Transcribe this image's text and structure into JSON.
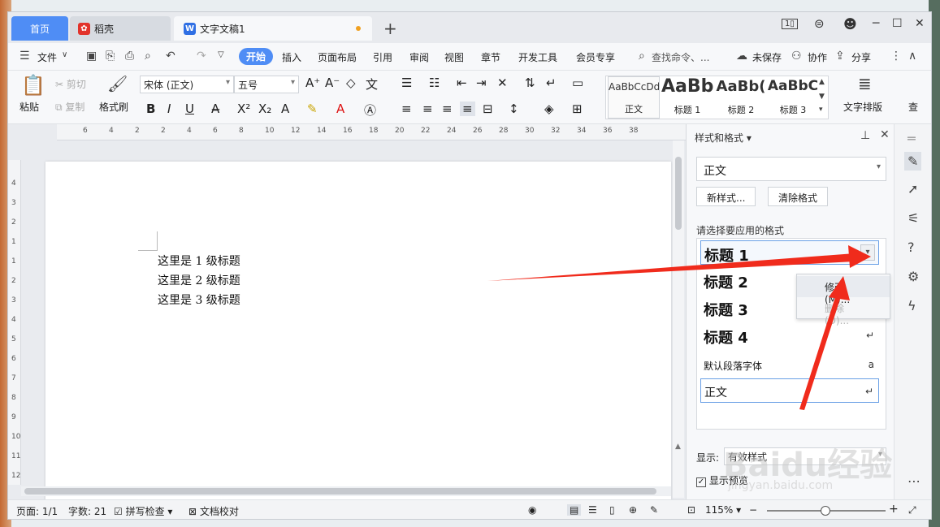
{
  "tabs": {
    "home": "首页",
    "daoke": "稻壳",
    "doc": "文字文稿1"
  },
  "menu": {
    "file": "文件",
    "start": "开始",
    "insert": "插入",
    "layout": "页面布局",
    "ref": "引用",
    "review": "审阅",
    "view": "视图",
    "chapter": "章节",
    "dev": "开发工具",
    "member": "会员专享",
    "search": "查找命令、...",
    "unsaved": "未保存",
    "collab": "协作",
    "share": "分享"
  },
  "ribbon": {
    "paste": "粘贴",
    "cut": "剪切",
    "copy": "复制",
    "format_painter": "格式刷",
    "font": "宋体 (正文)",
    "size": "五号",
    "text_layout": "文字排版",
    "find": "查"
  },
  "gallery": [
    {
      "preview": "AaBbCcDd",
      "name": "正文"
    },
    {
      "preview": "AaBb",
      "name": "标题 1"
    },
    {
      "preview": "AaBb(",
      "name": "标题 2"
    },
    {
      "preview": "AaBbC",
      "name": "标题 3"
    }
  ],
  "ruler": {
    "h": [
      "6",
      "4",
      "2",
      "2",
      "4",
      "6",
      "8",
      "10",
      "12",
      "14",
      "16",
      "18",
      "20",
      "22",
      "24",
      "26",
      "28",
      "30",
      "32",
      "34",
      "36",
      "38"
    ],
    "v": [
      "4",
      "3",
      "2",
      "1",
      "1",
      "2",
      "3",
      "4",
      "5",
      "6",
      "7",
      "8",
      "9",
      "10",
      "11",
      "12"
    ]
  },
  "document": {
    "lines": [
      "这里是 1 级标题",
      "这里是 2 级标题",
      "这里是 3 级标题"
    ]
  },
  "panel": {
    "title": "样式和格式",
    "current": "正文",
    "new_style": "新样式...",
    "clear": "清除格式",
    "choose": "请选择要应用的格式",
    "show_label": "显示:",
    "show_value": "有效样式",
    "preview_label": "显示预览",
    "styles": [
      {
        "name": "标题  1",
        "mark": ""
      },
      {
        "name": "标题  2",
        "mark": ""
      },
      {
        "name": "标题  3",
        "mark": ""
      },
      {
        "name": "标题  4",
        "mark": "↵"
      },
      {
        "name": "默认段落字体",
        "mark": "a"
      },
      {
        "name": "正文",
        "mark": "↵"
      }
    ]
  },
  "context_menu": {
    "modify": "修改(M)...",
    "delete": "删除(D)..."
  },
  "status": {
    "page": "页面: 1/1",
    "words": "字数: 21",
    "spell": "拼写检查",
    "proof": "文档校对",
    "zoom": "115%"
  },
  "watermark": {
    "brand": "Baidu经验",
    "url": "jingyan.baidu.com"
  },
  "colors": {
    "accent": "#4f8df5",
    "arrow": "#f02b1c"
  }
}
